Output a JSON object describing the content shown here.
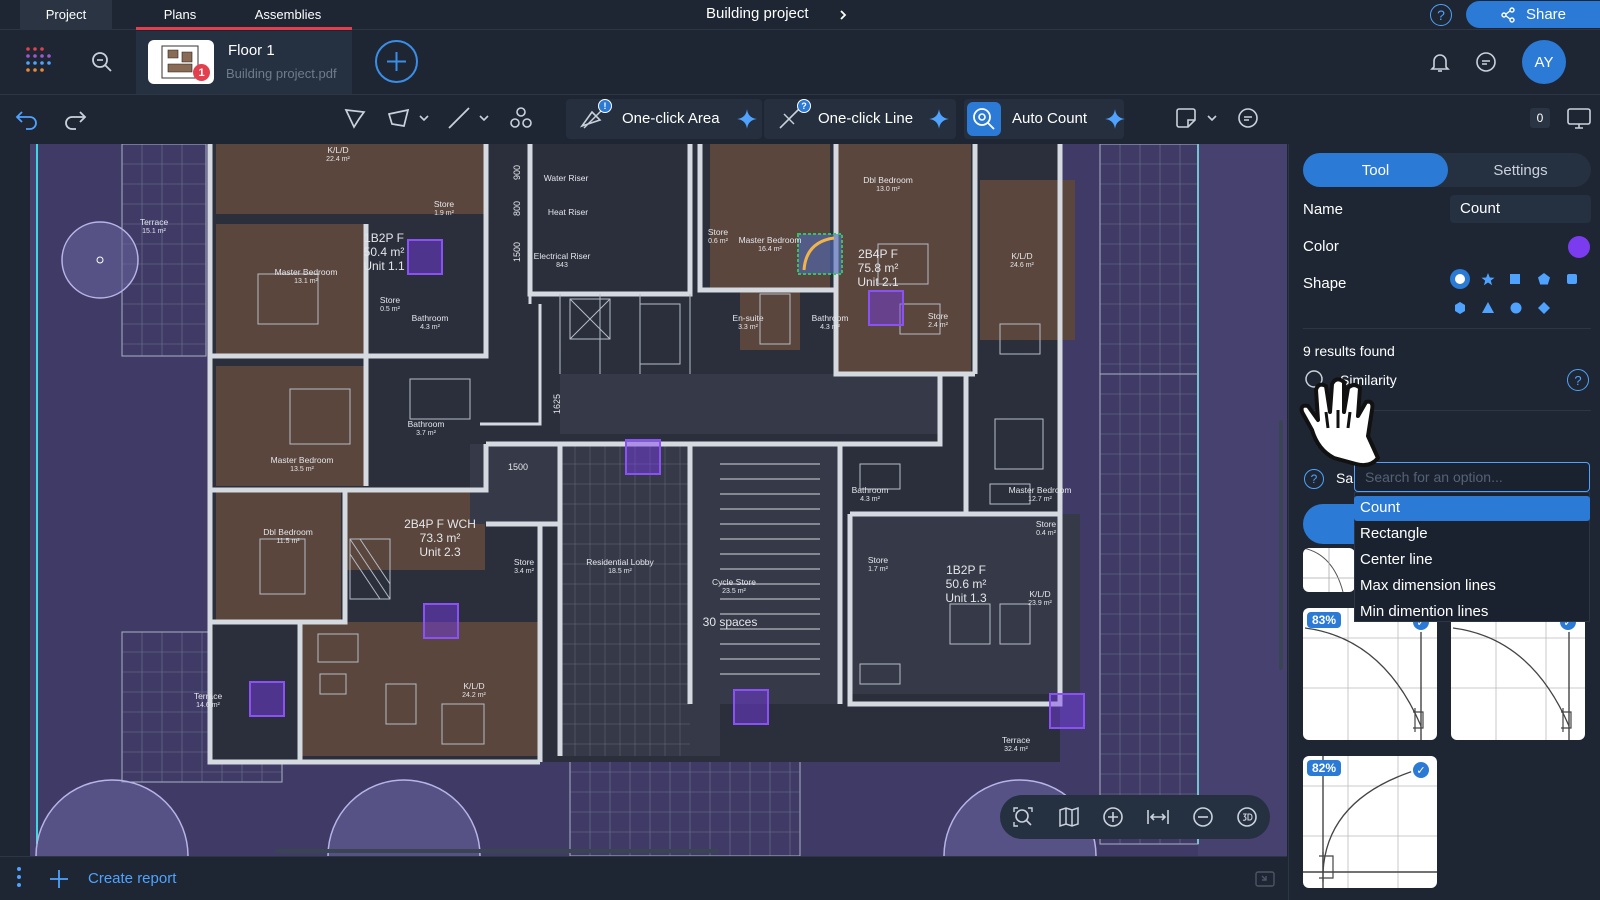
{
  "topnav": {
    "tabs": [
      {
        "label": "Project",
        "active": true
      },
      {
        "label": "Plans",
        "active": false
      },
      {
        "label": "Assemblies",
        "active": false
      }
    ],
    "project_title": "Building project",
    "share_label": "Share"
  },
  "file": {
    "name": "Floor 1",
    "source": "Building project.pdf",
    "badge_count": "1"
  },
  "user": {
    "initials": "AY"
  },
  "toolbar": {
    "one_click_area": "One-click Area",
    "one_click_line": "One-click Line",
    "auto_count": "Auto Count",
    "badge_area": "!",
    "badge_line": "?",
    "counter": "0"
  },
  "panel": {
    "tab_tool": "Tool",
    "tab_settings": "Settings",
    "name_label": "Name",
    "name_value": "Count",
    "color_label": "Color",
    "color_value": "#7b3cf0",
    "shape_label": "Shape",
    "results": "9 results found",
    "similarity_label": "Similarity",
    "search_label": "Sa",
    "search_placeholder": "Search for an option...",
    "options": [
      "Count",
      "Rectangle",
      "Center line",
      "Max dimension lines",
      "Min dimention lines"
    ],
    "selected_option": "Count",
    "cards": [
      {
        "pct": "83%",
        "checked": true
      },
      {
        "pct": "",
        "checked": true
      },
      {
        "pct": "82%",
        "checked": true
      }
    ]
  },
  "bottom": {
    "create_report": "Create report"
  },
  "plan": {
    "rooms": [
      {
        "t": "K/L/D",
        "s": "22.4 m²"
      },
      {
        "t": "Terrace",
        "s": "15.1 m²"
      },
      {
        "t": "Store",
        "s": "1.9 m²"
      },
      {
        "t": "1B2P F",
        "s": "50.4 m²",
        "u": "Unit 1.1"
      },
      {
        "t": "Master Bedroom",
        "s": "13.1 m²"
      },
      {
        "t": "Store",
        "s": "0.5 m²"
      },
      {
        "t": "Bathroom",
        "s": "4.3 m²"
      },
      {
        "t": "Water Riser",
        "s": ""
      },
      {
        "t": "Heat Riser",
        "s": ""
      },
      {
        "t": "Electrical Riser",
        "s": "843"
      },
      {
        "t": "Store",
        "s": "0.6 m²"
      },
      {
        "t": "Master Bedroom",
        "s": "16.4 m²"
      },
      {
        "t": "Dbl Bedroom",
        "s": "13.0 m²"
      },
      {
        "t": "2B4P F",
        "s": "75.8 m²",
        "u": "Unit 2.1"
      },
      {
        "t": "K/L/D",
        "s": "24.6 m²"
      },
      {
        "t": "Store",
        "s": "2.4 m²"
      },
      {
        "t": "Bathroom",
        "s": "4.3 m²"
      },
      {
        "t": "En-suite",
        "s": "3.3 m²"
      },
      {
        "t": "Bathroom",
        "s": "3.7 m²"
      },
      {
        "t": "Master Bedroom",
        "s": "13.5 m²"
      },
      {
        "t": "2B4P F WCH",
        "s": "73.3 m²",
        "u": "Unit 2.3"
      },
      {
        "t": "Dbl Bedroom",
        "s": "11.5 m²"
      },
      {
        "t": "Store",
        "s": "3.4 m²"
      },
      {
        "t": "Residential Lobby",
        "s": "18.5 m²"
      },
      {
        "t": "Cycle Store",
        "s": "23.5 m²"
      },
      {
        "t": "30 spaces",
        "s": ""
      },
      {
        "t": "Bathroom",
        "s": "4.3 m²"
      },
      {
        "t": "Master Bedroom",
        "s": "12.7 m²"
      },
      {
        "t": "Store",
        "s": "0.4 m²"
      },
      {
        "t": "Store",
        "s": "1.7 m²"
      },
      {
        "t": "1B2P F",
        "s": "50.6 m²",
        "u": "Unit 1.3"
      },
      {
        "t": "K/L/D",
        "s": "23.9 m²"
      },
      {
        "t": "K/L/D",
        "s": "24.2 m²"
      },
      {
        "t": "Terrace",
        "s": "14.6 m²"
      },
      {
        "t": "Terrace",
        "s": "32.4 m²"
      }
    ],
    "dims": [
      "900",
      "800",
      "1500",
      "1625",
      "1500"
    ]
  }
}
